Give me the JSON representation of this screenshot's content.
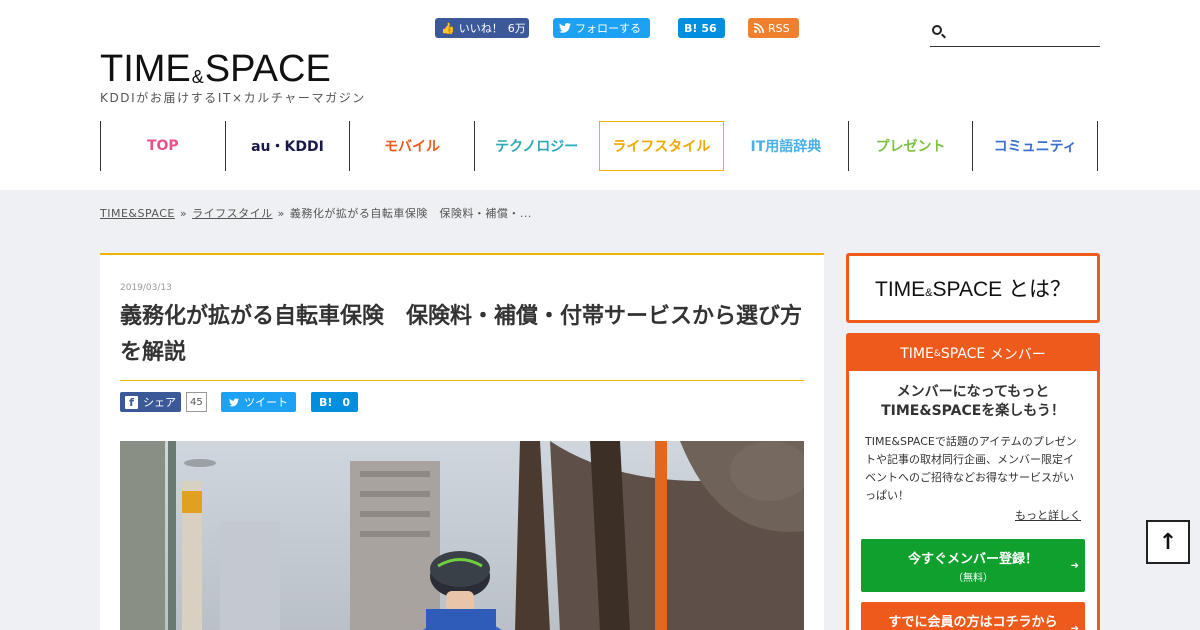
{
  "header": {
    "social": {
      "facebook_label": "いいね！",
      "facebook_count": "6万",
      "twitter_label": "フォローする",
      "hatena_label": "B!",
      "hatena_count": "56",
      "rss_label": "RSS"
    },
    "search": {
      "placeholder": ""
    },
    "logo": {
      "part1": "TIME",
      "amp": "&",
      "part2": "SPACE"
    },
    "tagline": "KDDIがお届けするIT×カルチャーマガジン",
    "nav": [
      {
        "label": "TOP",
        "color": "#e8528c"
      },
      {
        "label": "au・KDDI",
        "color": "#1a1a4a"
      },
      {
        "label": "モバイル",
        "color": "#ee5a1c"
      },
      {
        "label": "テクノロジー",
        "color": "#2aa8b8"
      },
      {
        "label": "ライフスタイル",
        "color": "#f0a800"
      },
      {
        "label": "IT用語辞典",
        "color": "#4ab0e8"
      },
      {
        "label": "プレゼント",
        "color": "#7cc142"
      },
      {
        "label": "コミュニティ",
        "color": "#3a6fd0"
      }
    ]
  },
  "breadcrumb": {
    "home": "TIME&SPACE",
    "category": "ライフスタイル",
    "current": "義務化が拡がる自転車保険　保険料・補償・..."
  },
  "article": {
    "date": "2019/03/13",
    "title": "義務化が拡がる自転車保険　保険料・補償・付帯サービスから選び方を解説",
    "share": {
      "facebook_label": "シェア",
      "facebook_count": "45",
      "twitter_label": "ツイート",
      "hatena_label": "B!",
      "hatena_count": "0"
    }
  },
  "sidebar": {
    "about": {
      "part1": "TIME",
      "amp": "&",
      "part2": "SPACE",
      "suffix": "とは？"
    },
    "member": {
      "head_part1": "TIME",
      "head_amp": "&",
      "head_part2": "SPACE",
      "head_suffix": "メンバー",
      "lead_line1": "メンバーになってもっと",
      "lead_line2": "TIME&SPACEを楽しもう！",
      "description": "TIME&SPACEで話題のアイテムのプレゼントや記事の取材同行企画、メンバー限定イベントへのご招待などお得なサービスがいっぱい！",
      "more_link": "もっと詳しく",
      "register_label": "今すぐメンバー登録！",
      "register_sub": "（無料）",
      "login_label": "すでに会員の方はコチラから"
    }
  },
  "scroll_top_label": "↑",
  "colors": {
    "accent_orange": "#ee5a1c",
    "accent_yellow": "#f0b400",
    "register_green": "#0fa02d"
  }
}
